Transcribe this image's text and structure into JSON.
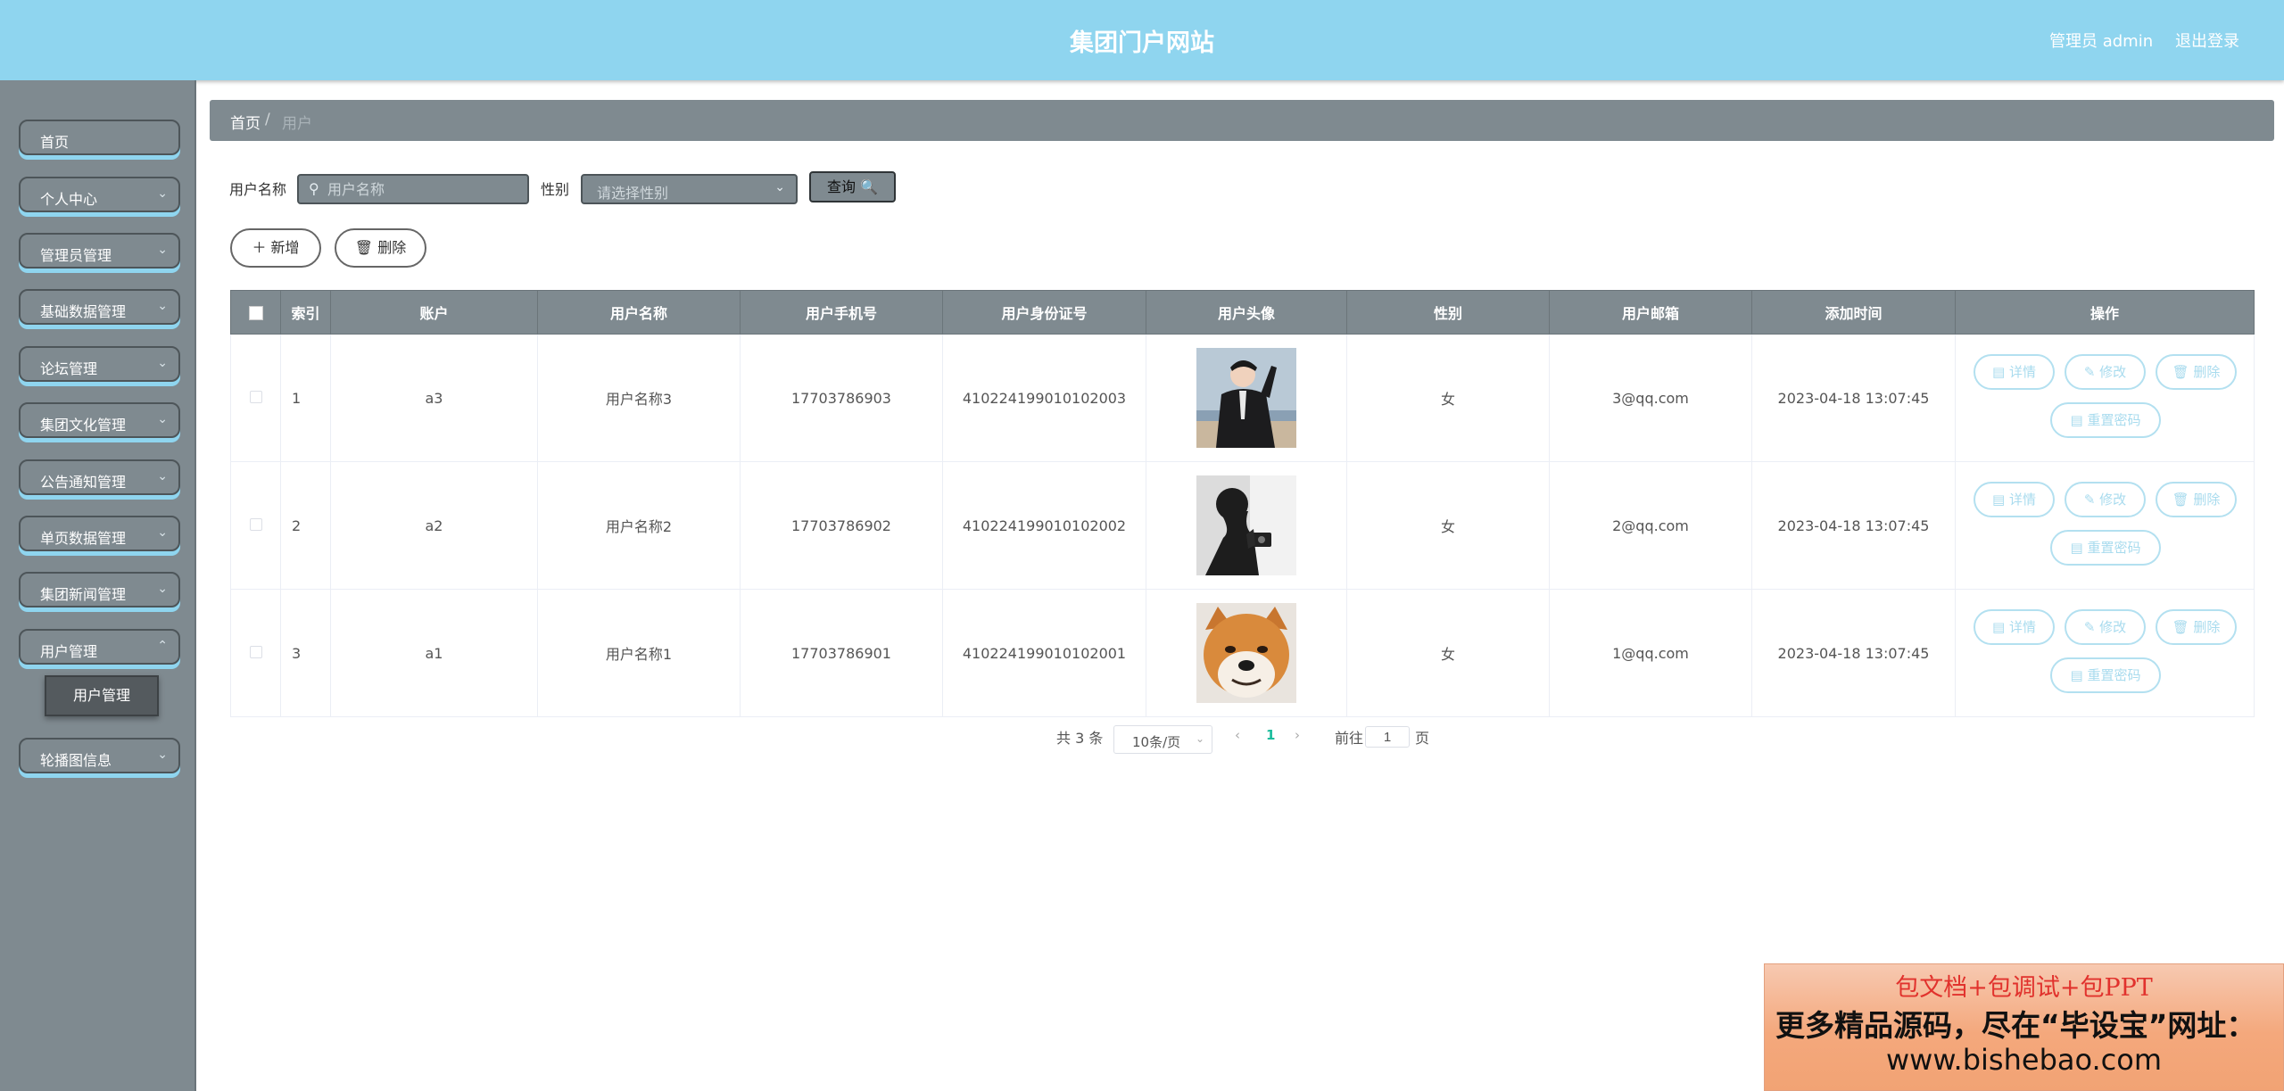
{
  "header": {
    "title": "集团门户网站",
    "admin_label": "管理员 admin",
    "logout_label": "退出登录"
  },
  "sidebar": {
    "items": [
      {
        "label": "首页",
        "chevron": false
      },
      {
        "label": "个人中心",
        "chevron": true
      },
      {
        "label": "管理员管理",
        "chevron": true
      },
      {
        "label": "基础数据管理",
        "chevron": true
      },
      {
        "label": "论坛管理",
        "chevron": true
      },
      {
        "label": "集团文化管理",
        "chevron": true
      },
      {
        "label": "公告通知管理",
        "chevron": true
      },
      {
        "label": "单页数据管理",
        "chevron": true
      },
      {
        "label": "集团新闻管理",
        "chevron": true
      },
      {
        "label": "用户管理",
        "chevron": true
      },
      {
        "label": "轮播图信息",
        "chevron": true
      }
    ],
    "submenu_label": "用户管理"
  },
  "breadcrumb": {
    "home": "首页",
    "separator": "/",
    "current": "用户"
  },
  "search": {
    "name_label": "用户名称",
    "name_placeholder": "用户名称",
    "gender_label": "性别",
    "gender_placeholder": "请选择性别",
    "query_label": "查询 🔍"
  },
  "actions": {
    "add_label": "＋ 新增",
    "delete_label": "🗑 删除"
  },
  "table": {
    "headers": [
      "索引",
      "账户",
      "用户名称",
      "用户手机号",
      "用户身份证号",
      "用户头像",
      "性别",
      "用户邮箱",
      "添加时间",
      "操作"
    ],
    "rows": [
      {
        "index": "1",
        "account": "a3",
        "name": "用户名称3",
        "phone": "17703786903",
        "id_card": "410224199010102003",
        "avatar": "person-jacket-photo",
        "gender": "女",
        "email": "3@qq.com",
        "time": "2023-04-18 13:07:45"
      },
      {
        "index": "2",
        "account": "a2",
        "name": "用户名称2",
        "phone": "17703786902",
        "id_card": "410224199010102002",
        "avatar": "silhouette-camera-photo",
        "gender": "女",
        "email": "2@qq.com",
        "time": "2023-04-18 13:07:45"
      },
      {
        "index": "3",
        "account": "a1",
        "name": "用户名称1",
        "phone": "17703786901",
        "id_card": "410224199010102001",
        "avatar": "shiba-dog-photo",
        "gender": "女",
        "email": "1@qq.com",
        "time": "2023-04-18 13:07:45"
      }
    ],
    "op_labels": {
      "detail": "详情",
      "edit": "修改",
      "delete": "删除",
      "reset": "重置密码"
    }
  },
  "pagination": {
    "total": "共 3 条",
    "page_size": "10条/页",
    "current_page": "1",
    "goto_label": "前往",
    "goto_value": "1",
    "page_suffix": "页",
    "prev": "‹",
    "next": "›"
  },
  "ad": {
    "line1": "包文档+包调试+包PPT",
    "line2": "更多精品源码，尽在“毕设宝”网址：",
    "line3": "www.bishebao.com"
  },
  "colors": {
    "header_bg": "#8fd5ef",
    "sidebar_bg": "#7f8a90",
    "accent": "#8fd5ef",
    "op_border": "#b3e0f0"
  }
}
